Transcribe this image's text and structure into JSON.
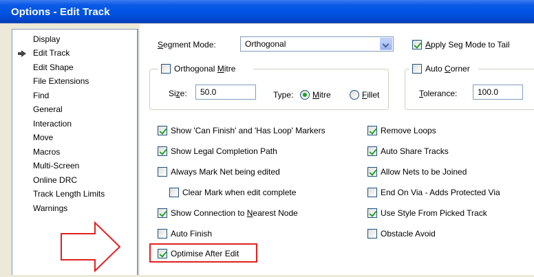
{
  "window": {
    "title": "Options - Edit Track"
  },
  "nav": {
    "items": [
      {
        "label": "Display",
        "selected": false
      },
      {
        "label": "Edit Track",
        "selected": true
      },
      {
        "label": "Edit Shape",
        "selected": false
      },
      {
        "label": "File Extensions",
        "selected": false
      },
      {
        "label": "Find",
        "selected": false
      },
      {
        "label": "General",
        "selected": false
      },
      {
        "label": "Interaction",
        "selected": false
      },
      {
        "label": "Move",
        "selected": false
      },
      {
        "label": "Macros",
        "selected": false
      },
      {
        "label": "Multi-Screen",
        "selected": false
      },
      {
        "label": "Online DRC",
        "selected": false
      },
      {
        "label": "Track Length Limits",
        "selected": false
      },
      {
        "label": "Warnings",
        "selected": false
      }
    ],
    "selected_icon": "arrow-right-icon"
  },
  "segment_mode": {
    "label_u": "S",
    "label_rest": "egment Mode:",
    "value": "Orthogonal"
  },
  "apply_seg_mode": {
    "label_u": "A",
    "label_rest": "pply Seg Mode to Tail",
    "checked": true
  },
  "orthogonal_mitre": {
    "label_pre": "Orthogonal ",
    "label_u": "M",
    "label_rest": "itre",
    "checked": false,
    "size_label_pre": "Si",
    "size_label_u": "z",
    "size_label_rest": "e:",
    "size_value": "50.0",
    "type_label": "Type:",
    "mitre_u": "M",
    "mitre_rest": "itre",
    "mitre_checked": true,
    "fillet_u": "F",
    "fillet_rest": "illet",
    "fillet_checked": false
  },
  "auto_corner": {
    "label_pre": "Auto ",
    "label_u": "C",
    "label_rest": "orner",
    "checked": false,
    "tolerance_u": "T",
    "tolerance_rest": "olerance:",
    "tolerance_value": "100.0"
  },
  "options_left": [
    {
      "label": "Show 'Can Finish' and 'Has Loop' Markers",
      "checked": true
    },
    {
      "label": "Show Legal Completion Path",
      "checked": true
    },
    {
      "label": "Always Mark Net being edited",
      "checked": false
    },
    {
      "label": "Clear Mark when edit complete",
      "checked": false
    },
    {
      "label_pre": "Show Connection to ",
      "label_u": "N",
      "label_rest": "earest Node",
      "checked": true
    },
    {
      "label": "Auto Finish",
      "checked": false
    },
    {
      "label": "Optimise After Edit",
      "checked": true
    }
  ],
  "options_right": [
    {
      "label": "Remove Loops",
      "checked": true
    },
    {
      "label": "Auto Share Tracks",
      "checked": true
    },
    {
      "label": "Allow Nets to be Joined",
      "checked": true
    },
    {
      "label": "End On Via - Adds Protected Via",
      "checked": false
    },
    {
      "label": "Use Style From Picked Track",
      "checked": true
    },
    {
      "label": "Obstacle Avoid",
      "checked": false
    }
  ],
  "colors": {
    "title_blue": "#0054e3",
    "highlight_red": "#e02020",
    "check_green": "#21a121",
    "dialog_bg": "#ece9d8"
  }
}
